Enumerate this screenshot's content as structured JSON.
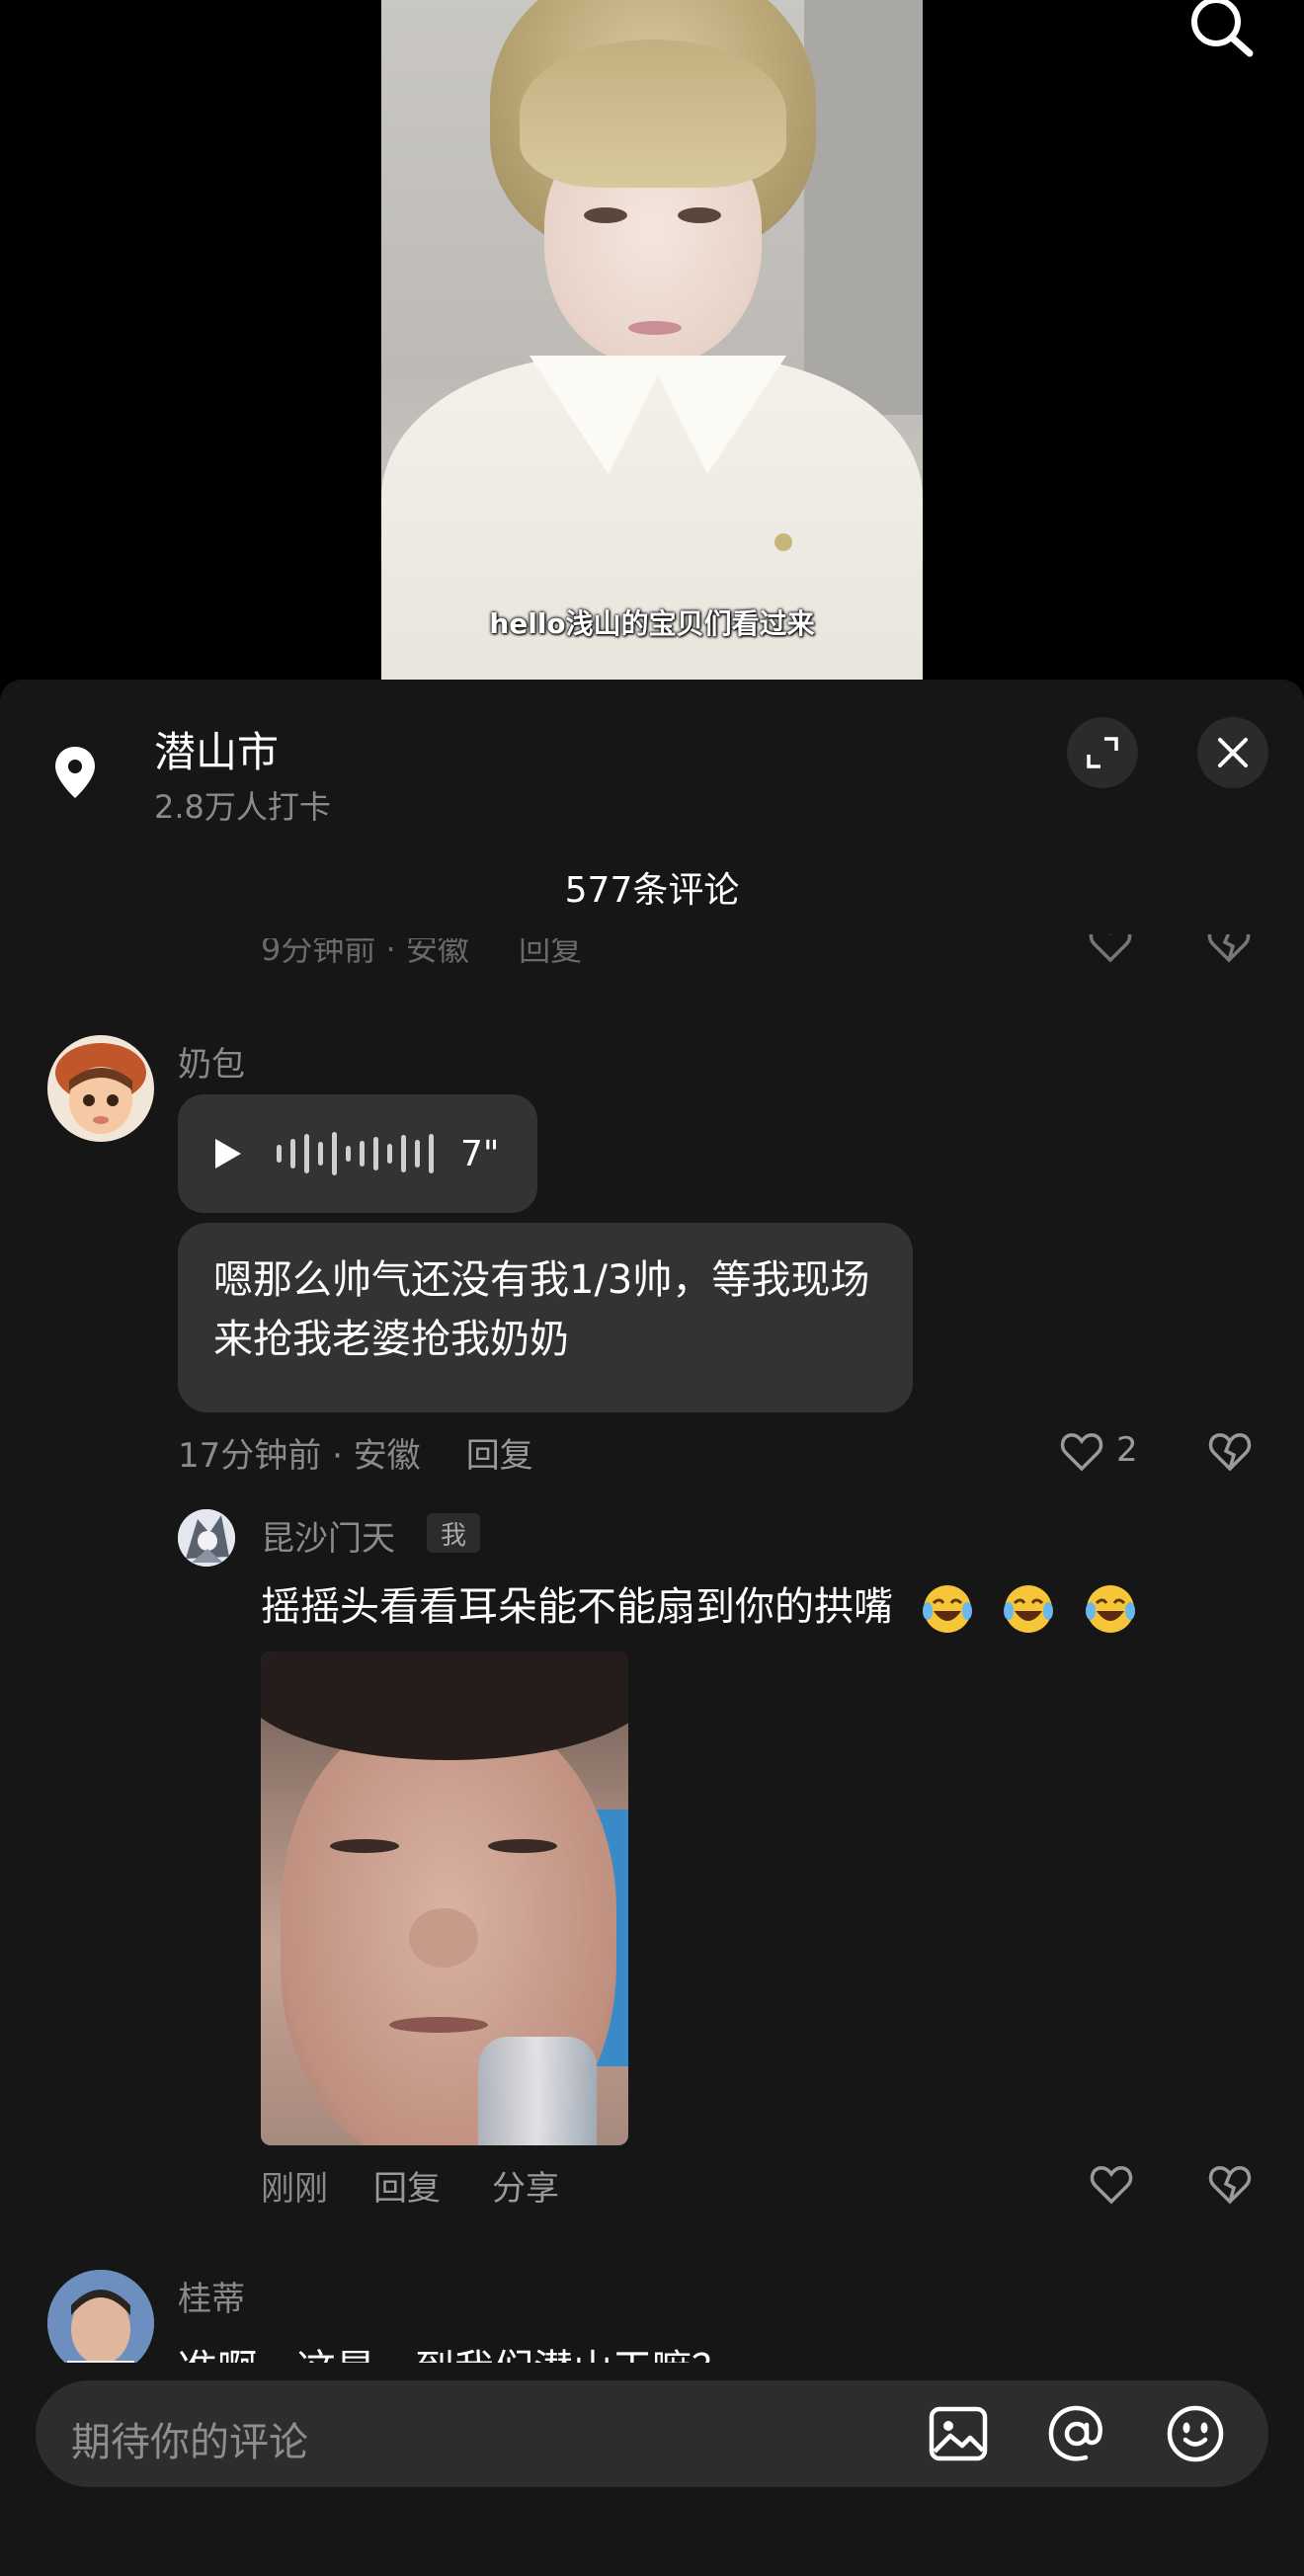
{
  "video": {
    "caption": "hello浅山的宝贝们看过来"
  },
  "sheet": {
    "location_title": "潜山市",
    "location_subtitle": "2.8万人打卡",
    "comment_count": "577条评论",
    "ghost_row": {
      "time": "9分钟前 · 安徽",
      "reply": "回复"
    }
  },
  "comments": [
    {
      "username": "奶包",
      "voice": {
        "duration": "7\""
      },
      "text": "嗯那么帅气还没有我1/3帅，等我现场来抢我老婆抢我奶奶",
      "time_location": "17分钟前 · 安徽",
      "reply_label": "回复",
      "likes": "2",
      "replies": [
        {
          "username": "昆沙门天",
          "badge": "我",
          "text": "摇摇头看看耳朵能不能扇到你的拱嘴",
          "emoji_count": 3,
          "time": "刚刚",
          "reply_label": "回复",
          "share_label": "分享"
        }
      ]
    },
    {
      "username": "桂蒂",
      "text": "准啊，这是，到我们潜山干嘛？"
    }
  ],
  "input": {
    "placeholder": "期待你的评论"
  },
  "colors": {
    "sheet_bg": "#161616",
    "bubble_bg": "#333333",
    "secondary_text": "#8a8a8a",
    "input_bg": "#2d2d2d"
  },
  "icons": [
    "search-icon",
    "location-pin-icon",
    "expand-icon",
    "close-icon",
    "play-icon",
    "heart-icon",
    "broken-heart-icon",
    "image-icon",
    "at-icon",
    "emoji-icon",
    "laughing-tears-emoji"
  ]
}
